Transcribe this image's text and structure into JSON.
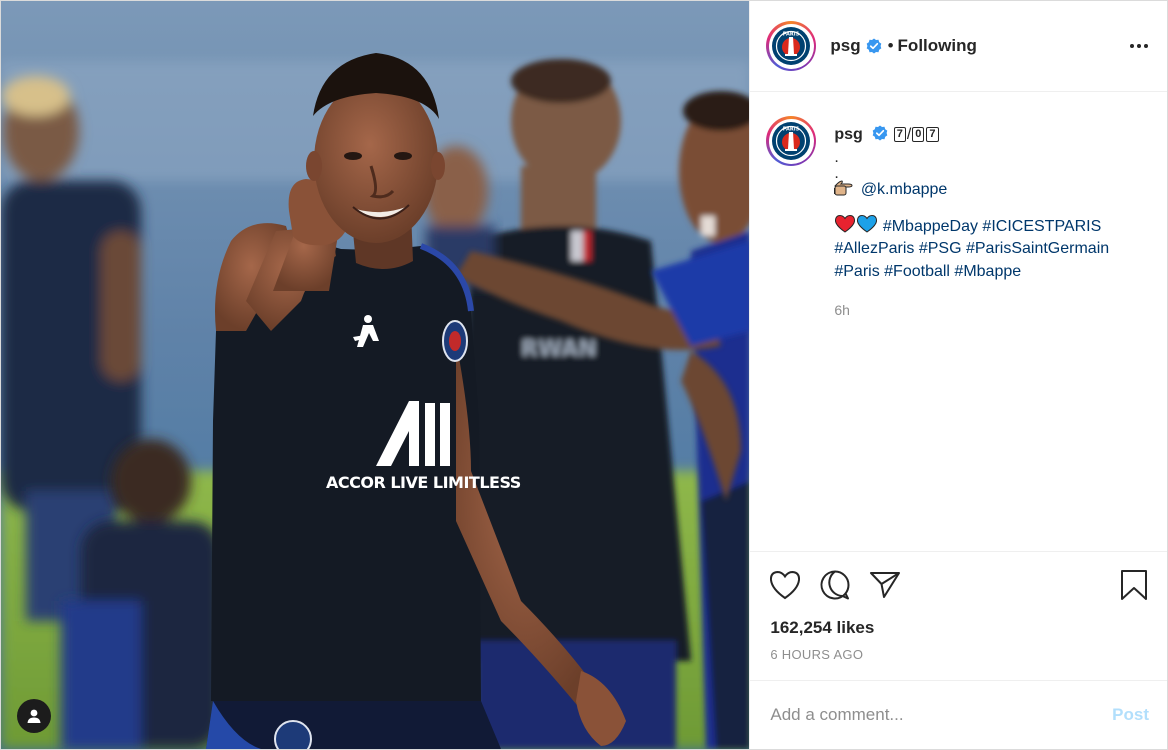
{
  "post": {
    "username": "psg",
    "verified": true,
    "follow_status": "Following",
    "separator": "•",
    "image_alt": "Player in a PSG training shirt pointing at the camera, teammates celebrating in the background"
  },
  "caption": {
    "username": "psg",
    "num_boxes": [
      "7",
      "0",
      "7"
    ],
    "num_slash": "/",
    "dot_line_1": ".",
    "dot_line_2": ".",
    "mention": "@k.mbappe",
    "hashtag_line_1": "#MbappeDay #ICICESTPARIS",
    "hashtag_line_2": "#AllezParis #PSG #ParisSaintGermain",
    "hashtag_line_3": "#Paris #Football #Mbappe",
    "time": "6h"
  },
  "likes": "162,254 likes",
  "posted_time": "6 HOURS AGO",
  "comment_box": {
    "placeholder": "Add a comment...",
    "post_label": "Post"
  },
  "colors": {
    "link": "#00376b",
    "verified": "#3897f0",
    "post_button_disabled": "#b2dffc",
    "psg_navy": "#004170",
    "psg_red": "#da291c"
  },
  "icons": {
    "more": "more-horizontal-icon",
    "like": "heart-outline-icon",
    "comment": "comment-bubble-icon",
    "share": "paper-plane-icon",
    "save": "bookmark-icon",
    "tag": "user-tag-icon"
  }
}
